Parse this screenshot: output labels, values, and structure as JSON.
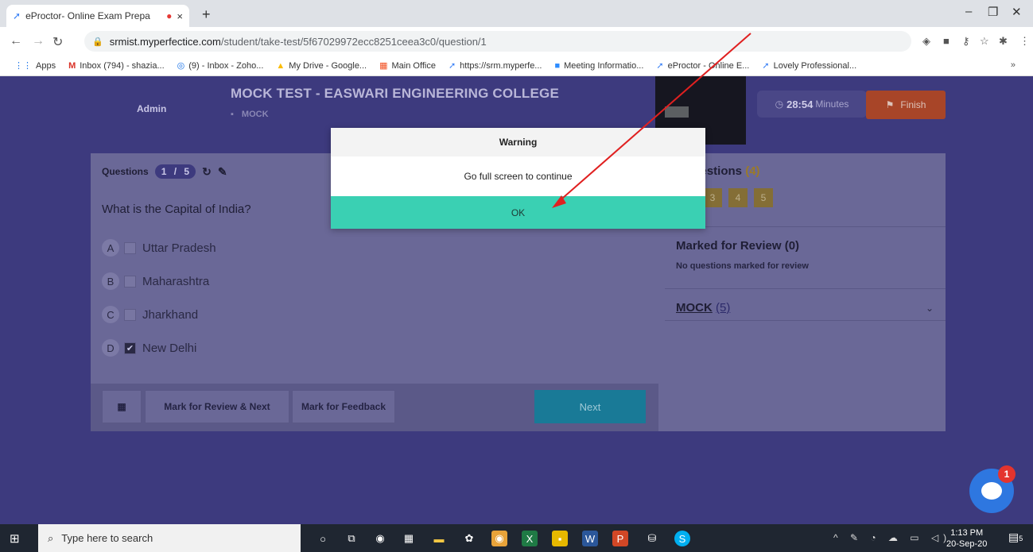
{
  "browser": {
    "tab_title": "eProctor- Online Exam Prepa",
    "new_tab": "+",
    "close_tab": "×",
    "url_host": "srmist.myperfectice.com",
    "url_path": "/student/take-test/5f67029972ecc8251ceea3c0/question/1",
    "bookmarks": [
      {
        "label": "Apps",
        "icon": "apps-grid-icon"
      },
      {
        "label": "Inbox (794) - shazia...",
        "icon": "gmail-icon"
      },
      {
        "label": "(9) - Inbox - Zoho...",
        "icon": "zoho-mail-icon"
      },
      {
        "label": "My Drive - Google...",
        "icon": "google-drive-icon"
      },
      {
        "label": "Main Office",
        "icon": "microsoft-icon"
      },
      {
        "label": "https://srm.myperfe...",
        "icon": "perfectice-icon"
      },
      {
        "label": "Meeting Informatio...",
        "icon": "zoom-icon"
      },
      {
        "label": "eProctor - Online E...",
        "icon": "perfectice-icon"
      },
      {
        "label": "Lovely Professional...",
        "icon": "perfectice-icon"
      }
    ],
    "bookmarks_more": "»"
  },
  "header": {
    "user": "Admin",
    "exam_title": "MOCK TEST - EASWARI ENGINEERING COLLEGE",
    "exam_type": "MOCK",
    "timer_value": "28:54",
    "timer_unit": "Minutes",
    "finish_label": "Finish"
  },
  "question": {
    "label": "Questions",
    "current": "1",
    "separator": "/",
    "total": "5",
    "text": "What is the Capital of India?",
    "options": [
      {
        "letter": "A",
        "text": "Uttar Pradesh",
        "checked": false
      },
      {
        "letter": "B",
        "text": "Maharashtra",
        "checked": false
      },
      {
        "letter": "C",
        "text": "Jharkhand",
        "checked": false
      },
      {
        "letter": "D",
        "text": "New Delhi",
        "checked": true
      }
    ],
    "mark_review_label": "Mark for Review & Next",
    "mark_feedback_label": "Mark for Feedback",
    "next_label": "Next"
  },
  "sidebar": {
    "unanswered_title": "ed Questions",
    "unanswered_count": "(4)",
    "unanswered_numbers": [
      "3",
      "4",
      "5"
    ],
    "review_title": "Marked for Review (0)",
    "review_text": "No questions marked for review",
    "section_name": "MOCK",
    "section_count": "(5)"
  },
  "modal": {
    "title": "Warning",
    "message": "Go full screen to continue",
    "ok_label": "OK"
  },
  "chat": {
    "badge": "1"
  },
  "taskbar": {
    "search_placeholder": "Type here to search",
    "time": "1:13 PM",
    "date": "20-Sep-20",
    "notifications": "5"
  },
  "colors": {
    "page_bg": "#3d3a7e",
    "modal_ok": "#3ad0b3",
    "finish": "#a84528",
    "next": "#197a97",
    "annotation_arrow": "#e02020"
  }
}
